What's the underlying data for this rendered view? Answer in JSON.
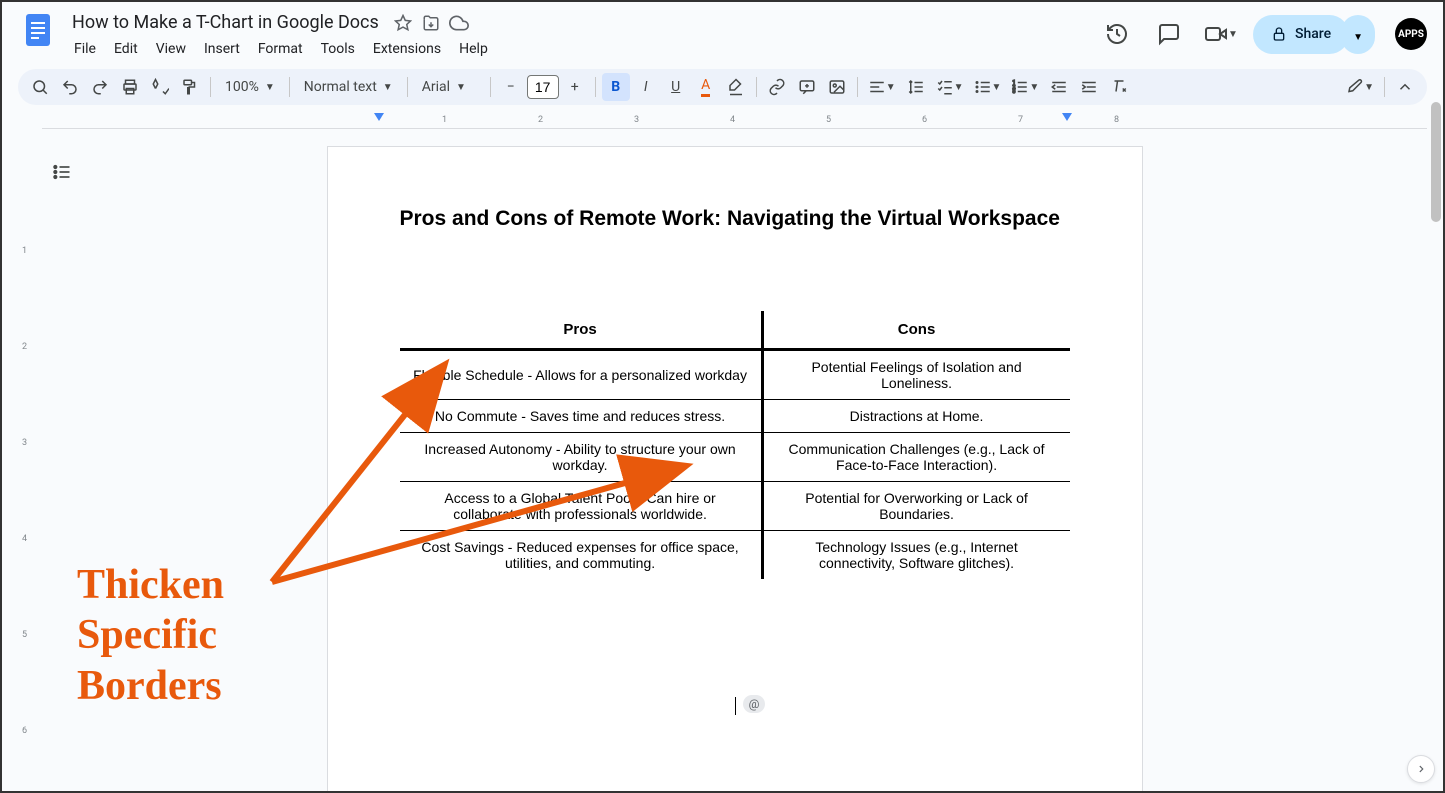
{
  "doc": {
    "title": "How to Make a T-Chart in Google Docs",
    "heading": "Pros and Cons of Remote Work: Navigating the Virtual Workspace"
  },
  "menu": {
    "file": "File",
    "edit": "Edit",
    "view": "View",
    "insert": "Insert",
    "format": "Format",
    "tools": "Tools",
    "extensions": "Extensions",
    "help": "Help"
  },
  "toolbar": {
    "zoom": "100%",
    "style": "Normal text",
    "font": "Arial",
    "fontSize": "17"
  },
  "share": {
    "label": "Share"
  },
  "avatar": {
    "text": "APPS"
  },
  "table": {
    "headers": {
      "pros": "Pros",
      "cons": "Cons"
    },
    "rows": [
      {
        "pro": "Flexible Schedule - Allows for a personalized workday",
        "con": "Potential Feelings of Isolation and Loneliness."
      },
      {
        "pro": "No Commute - Saves time and reduces stress.",
        "con": "Distractions at Home."
      },
      {
        "pro": "Increased Autonomy - Ability to structure your own workday.",
        "con": "Communication Challenges (e.g., Lack of Face-to-Face Interaction)."
      },
      {
        "pro": "Access to a Global Talent Pool - Can hire or collaborate with professionals worldwide.",
        "con": "Potential for Overworking or Lack of Boundaries."
      },
      {
        "pro": "Cost Savings - Reduced expenses for office space, utilities, and commuting.",
        "con": "Technology Issues (e.g., Internet connectivity, Software glitches)."
      }
    ]
  },
  "annotation": {
    "line1": "Thicken",
    "line2": "Specific",
    "line3": "Borders"
  },
  "ruler": {
    "m1": "1",
    "m2": "2",
    "m3": "3",
    "m4": "4",
    "m5": "5",
    "m6": "6",
    "m7": "7",
    "m8": "8"
  },
  "at": "@"
}
